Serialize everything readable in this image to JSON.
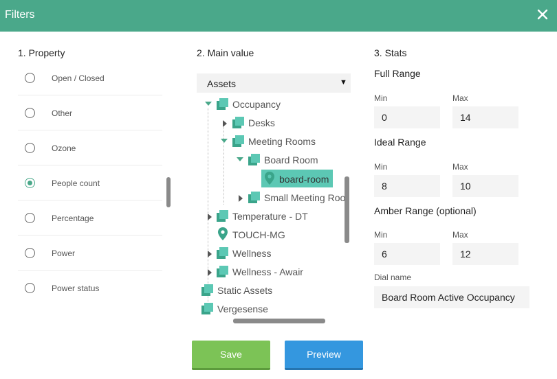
{
  "header": {
    "title": "Filters"
  },
  "property": {
    "title": "1. Property",
    "items": [
      {
        "label": "Open / Closed",
        "checked": false
      },
      {
        "label": "Other",
        "checked": false
      },
      {
        "label": "Ozone",
        "checked": false
      },
      {
        "label": "People count",
        "checked": true
      },
      {
        "label": "Percentage",
        "checked": false
      },
      {
        "label": "Power",
        "checked": false
      },
      {
        "label": "Power status",
        "checked": false
      }
    ]
  },
  "main": {
    "title": "2. Main value",
    "select_value": "Assets",
    "tree": [
      {
        "label": "Occupancy",
        "icon": "cube-icon",
        "state": "expanded"
      },
      {
        "label": "Desks",
        "icon": "cube-icon",
        "state": "collapsed"
      },
      {
        "label": "Meeting Rooms",
        "icon": "cube-icon",
        "state": "expanded"
      },
      {
        "label": "Board Room",
        "icon": "cube-icon",
        "state": "expanded"
      },
      {
        "label": "board-room",
        "icon": "location-pin-icon",
        "state": "leaf",
        "selected": true
      },
      {
        "label": "Small Meeting Room",
        "icon": "cube-icon",
        "state": "collapsed"
      },
      {
        "label": "Temperature - DT",
        "icon": "cube-icon",
        "state": "collapsed"
      },
      {
        "label": "TOUCH-MG",
        "icon": "location-pin-icon",
        "state": "leaf"
      },
      {
        "label": "Wellness",
        "icon": "cube-icon",
        "state": "collapsed"
      },
      {
        "label": "Wellness - Awair",
        "icon": "cube-icon",
        "state": "collapsed"
      },
      {
        "label": "Static Assets",
        "icon": "cube-icon",
        "state": "leaf"
      },
      {
        "label": "Vergesense",
        "icon": "cube-icon",
        "state": "leaf"
      }
    ]
  },
  "stats": {
    "title": "3. Stats",
    "full_range": {
      "title": "Full Range",
      "min_label": "Min",
      "max_label": "Max",
      "min": "0",
      "max": "14"
    },
    "ideal_range": {
      "title": "Ideal Range",
      "min_label": "Min",
      "max_label": "Max",
      "min": "8",
      "max": "10"
    },
    "amber_range": {
      "title": "Amber Range (optional)",
      "min_label": "Min",
      "max_label": "Max",
      "min": "6",
      "max": "12"
    },
    "dial_name_label": "Dial name",
    "dial_name": "Board Room Active Occupancy"
  },
  "buttons": {
    "save": "Save",
    "preview": "Preview"
  },
  "colors": {
    "header": "#4aa88a",
    "accent": "#4aa88a",
    "selected_node": "#5cc8b4",
    "save": "#7cc356",
    "preview": "#3497df"
  }
}
